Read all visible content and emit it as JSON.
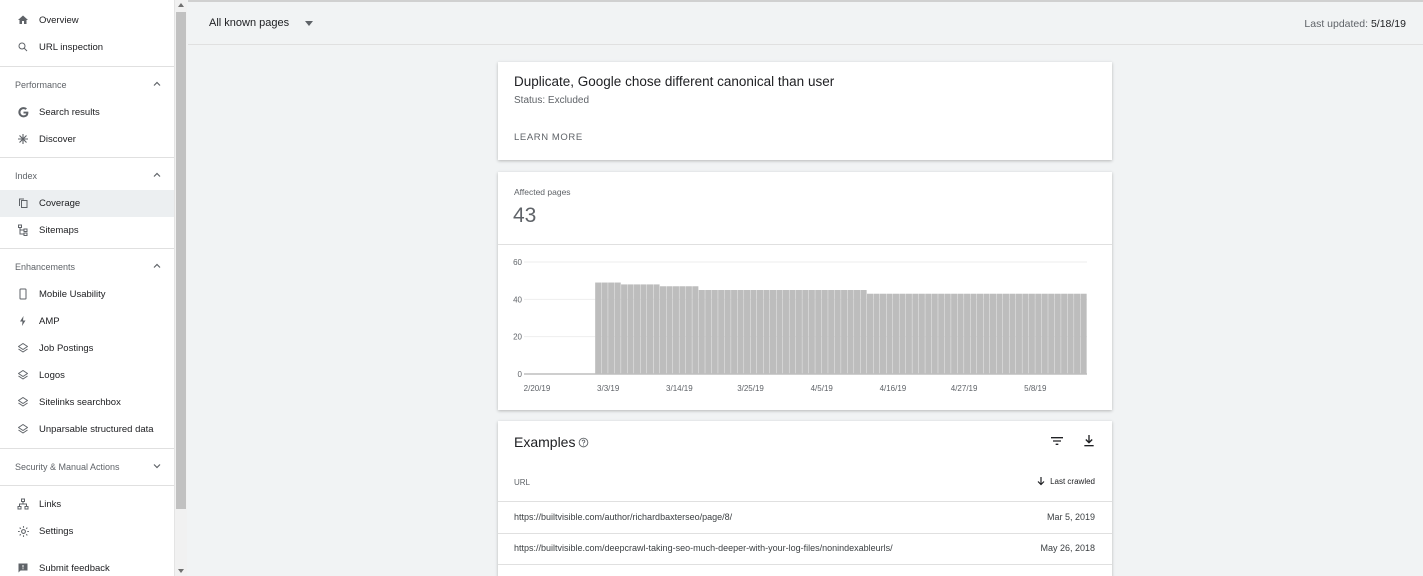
{
  "sidebar": {
    "top_items": [
      {
        "label": "Overview",
        "icon": "home-icon"
      },
      {
        "label": "URL inspection",
        "icon": "search-icon"
      }
    ],
    "performance": {
      "title": "Performance",
      "items": [
        {
          "label": "Search results",
          "icon": "google-icon"
        },
        {
          "label": "Discover",
          "icon": "asterisk-icon"
        }
      ]
    },
    "index": {
      "title": "Index",
      "items": [
        {
          "label": "Coverage",
          "icon": "copy-icon"
        },
        {
          "label": "Sitemaps",
          "icon": "sitemap-icon"
        }
      ]
    },
    "enhancements": {
      "title": "Enhancements",
      "items": [
        {
          "label": "Mobile Usability",
          "icon": "phone-icon"
        },
        {
          "label": "AMP",
          "icon": "lightning-icon"
        },
        {
          "label": "Job Postings",
          "icon": "layers-icon"
        },
        {
          "label": "Logos",
          "icon": "layers-icon"
        },
        {
          "label": "Sitelinks searchbox",
          "icon": "layers-icon"
        },
        {
          "label": "Unparsable structured data",
          "icon": "layers-icon"
        }
      ]
    },
    "security": {
      "title": "Security & Manual Actions"
    },
    "bottom_items": [
      {
        "label": "Links",
        "icon": "network-icon"
      },
      {
        "label": "Settings",
        "icon": "gear-icon"
      },
      {
        "label": "Submit feedback",
        "icon": "feedback-icon"
      }
    ]
  },
  "topbar": {
    "filter_label": "All known pages",
    "last_updated_label": "Last updated:",
    "last_updated_value": "5/18/19"
  },
  "issue": {
    "title": "Duplicate, Google chose different canonical than user",
    "status": "Status: Excluded",
    "learn_more": "LEARN MORE"
  },
  "affected": {
    "label": "Affected pages",
    "value": "43"
  },
  "chart_data": {
    "type": "bar",
    "ylim": [
      0,
      60
    ],
    "yticks": [
      0,
      20,
      40,
      60
    ],
    "xtick_labels": [
      "2/20/19",
      "3/3/19",
      "3/14/19",
      "3/25/19",
      "4/5/19",
      "4/16/19",
      "4/27/19",
      "5/8/19"
    ],
    "start_date": "2/20/19",
    "end_date": "5/17/19",
    "values": [
      0,
      0,
      0,
      0,
      0,
      0,
      0,
      0,
      0,
      0,
      0,
      49,
      49,
      49,
      49,
      48,
      48,
      48,
      48,
      48,
      48,
      47,
      47,
      47,
      47,
      47,
      47,
      45,
      45,
      45,
      45,
      45,
      45,
      45,
      45,
      45,
      45,
      45,
      45,
      45,
      45,
      45,
      45,
      45,
      45,
      45,
      45,
      45,
      45,
      45,
      45,
      45,
      45,
      43,
      43,
      43,
      43,
      43,
      43,
      43,
      43,
      43,
      43,
      43,
      43,
      43,
      43,
      43,
      43,
      43,
      43,
      43,
      43,
      43,
      43,
      43,
      43,
      43,
      43,
      43,
      43,
      43,
      43,
      43,
      43,
      43,
      43
    ],
    "bar_color": "#bdbdbd",
    "grid": true
  },
  "examples": {
    "title": "Examples",
    "col_url": "URL",
    "col_crawled": "Last crawled",
    "rows": [
      {
        "url": "https://builtvisible.com/author/richardbaxterseo/page/8/",
        "date": "Mar 5, 2019"
      },
      {
        "url": "https://builtvisible.com/deepcrawl-taking-seo-much-deeper-with-your-log-files/nonindexableurls/",
        "date": "May 26, 2018"
      }
    ]
  }
}
